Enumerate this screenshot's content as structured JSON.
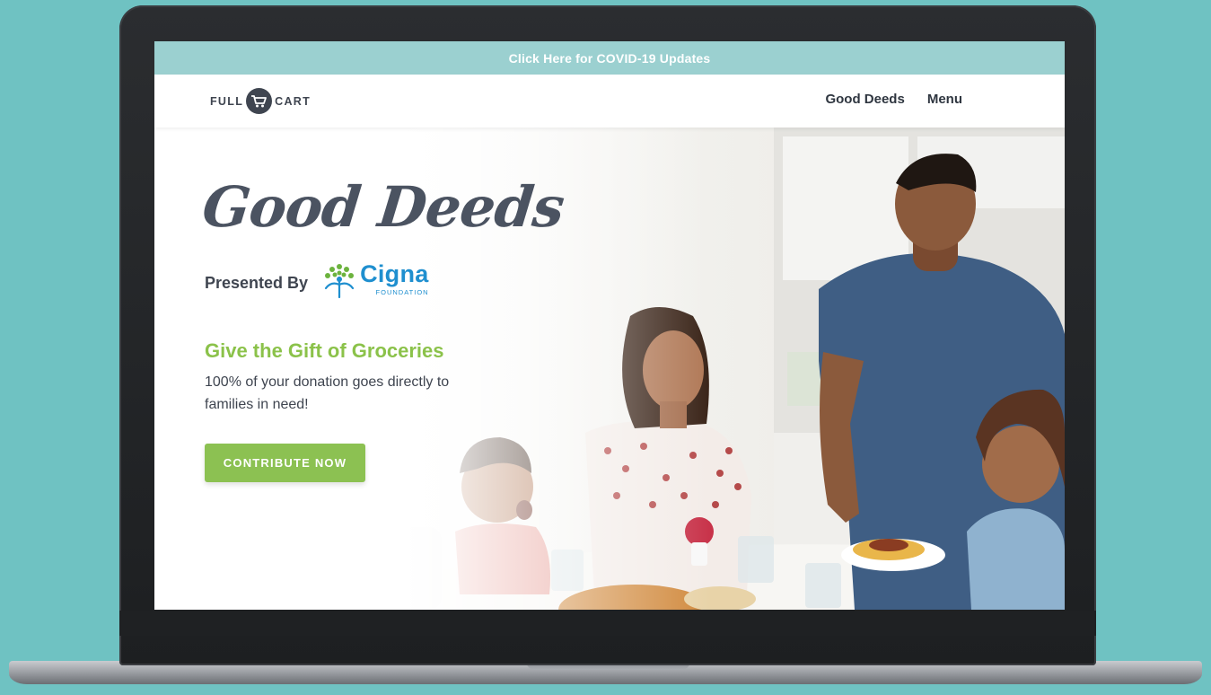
{
  "banner": {
    "text": "Click Here for COVID-19 Updates"
  },
  "header": {
    "logo_left": "FULL",
    "logo_right": "CART",
    "nav": {
      "good_deeds": "Good Deeds",
      "menu": "Menu"
    }
  },
  "hero": {
    "title": "Good Deeds",
    "presented_by": "Presented By",
    "sponsor_name": "Cigna",
    "sponsor_sub": "FOUNDATION",
    "tagline": "Give the Gift of Groceries",
    "description": "100% of your donation goes directly to families in need!",
    "cta_label": "CONTRIBUTE NOW"
  },
  "colors": {
    "background": "#6fc2c2",
    "banner": "#9bd0d0",
    "accent_green": "#8cc152",
    "text_dark": "#3f4550",
    "cigna_blue": "#1f8fcf"
  },
  "icons": {
    "logo_mark": "shopping-cart-icon",
    "sponsor_mark": "tree-of-life-icon"
  }
}
